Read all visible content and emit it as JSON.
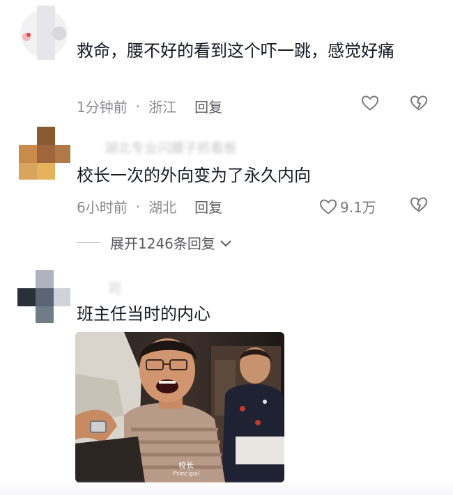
{
  "comments": [
    {
      "username": "",
      "text": "救命，腰不好的看到这个吓一跳，感觉好痛",
      "time": "1分钟前",
      "location": "浙江",
      "reply": "回复",
      "likes": ""
    },
    {
      "username": "湖北专业闪腰子抓看板",
      "text": "校长一次的外向变为了永久内向",
      "time": "6小时前",
      "location": "湖北",
      "reply": "回复",
      "likes": "9.1万",
      "expand": "展开1246条回复"
    },
    {
      "username": "司",
      "text": "班主任当时的内心",
      "image_caption": "校长",
      "image_caption_sub": "Principal"
    }
  ],
  "icons": {
    "like": "heart-outline-icon",
    "dislike": "broken-heart-icon",
    "expand": "chevron-down-icon"
  }
}
